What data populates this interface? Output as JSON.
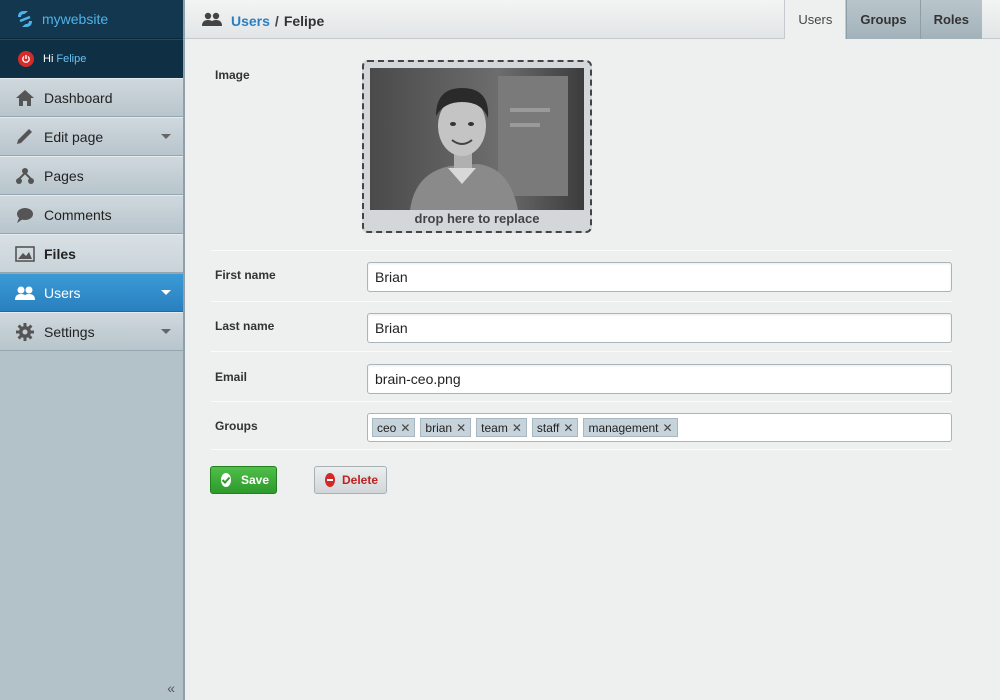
{
  "brand": {
    "name": "mywebsite"
  },
  "user": {
    "greeting": "Hi",
    "name": "Felipe"
  },
  "nav": [
    {
      "label": "Dashboard",
      "icon": "home-icon"
    },
    {
      "label": "Edit page",
      "icon": "pencil-icon"
    },
    {
      "label": "Pages",
      "icon": "sitemap-icon"
    },
    {
      "label": "Comments",
      "icon": "comment-icon"
    },
    {
      "label": "Files",
      "icon": "image-icon"
    },
    {
      "label": "Users",
      "icon": "users-icon"
    },
    {
      "label": "Settings",
      "icon": "gear-icon"
    }
  ],
  "breadcrumb": {
    "section": "Users",
    "separator": "/",
    "current": "Felipe"
  },
  "tabs": [
    "Users",
    "Groups",
    "Roles"
  ],
  "form": {
    "image_label": "Image",
    "drop_text": "drop here to replace",
    "first_name_label": "First name",
    "first_name_value": "Brian",
    "last_name_label": "Last name",
    "last_name_value": "Brian",
    "email_label": "Email",
    "email_value": "brain-ceo.png",
    "groups_label": "Groups",
    "groups": [
      "ceo",
      "brian",
      "team",
      "staff",
      "management"
    ]
  },
  "actions": {
    "save": "Save",
    "delete": "Delete"
  },
  "colors": {
    "accent": "#2a80bf",
    "brand_bg": "#13374f",
    "save": "#2d9a2b",
    "delete": "#d42727"
  }
}
